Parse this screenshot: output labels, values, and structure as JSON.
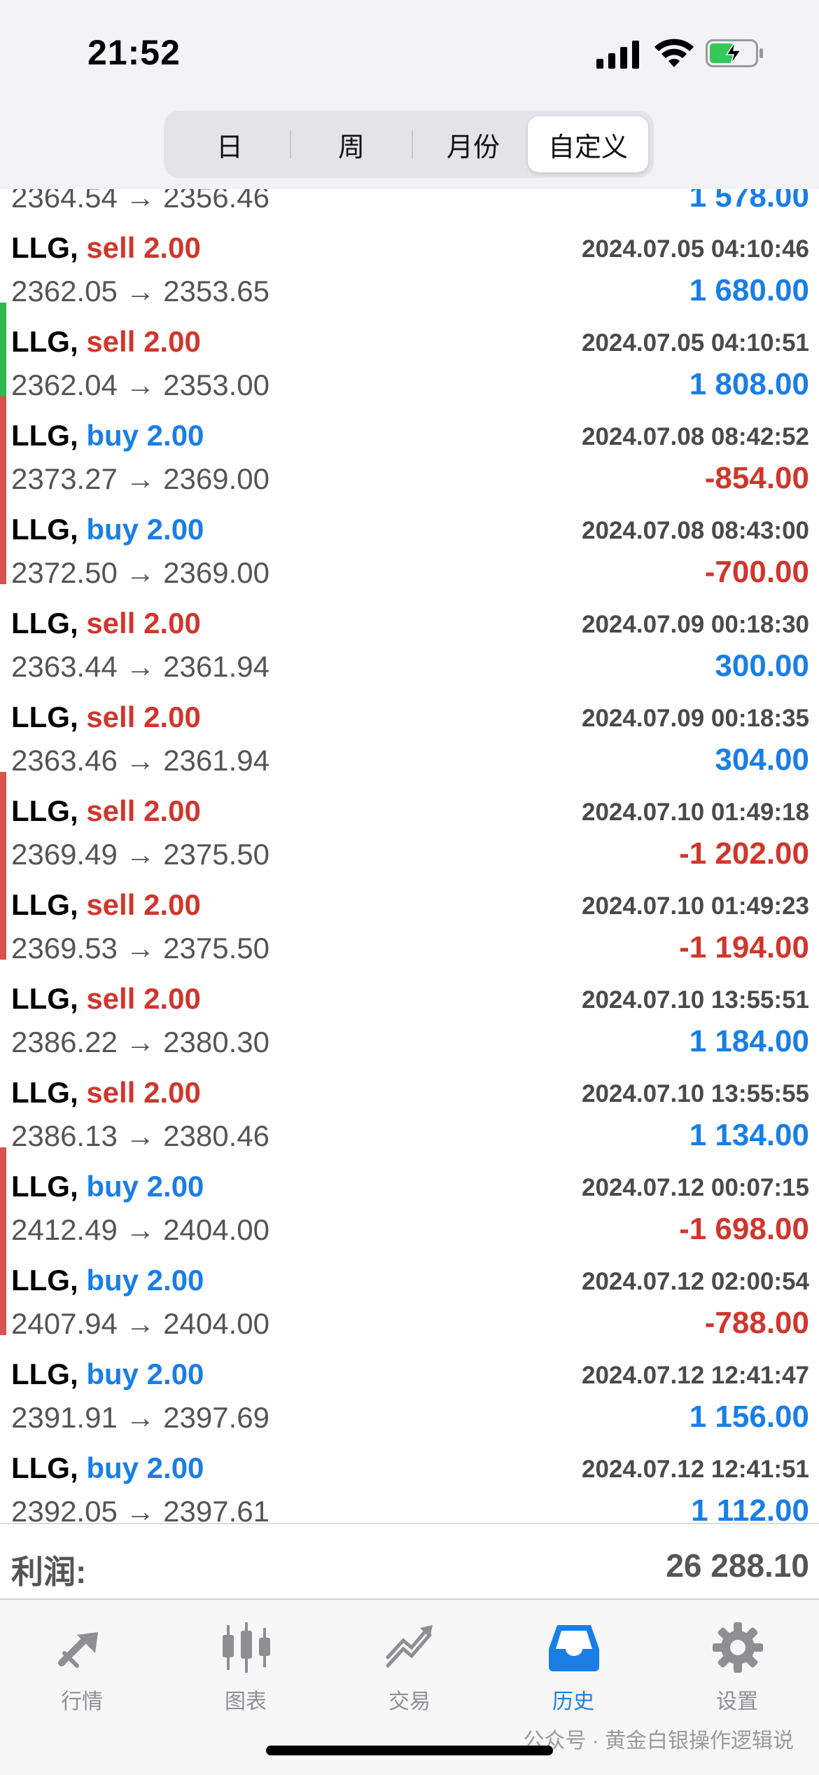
{
  "status": {
    "time": "21:52"
  },
  "segments": [
    {
      "label": "日",
      "active": false
    },
    {
      "label": "周",
      "active": false
    },
    {
      "label": "月份",
      "active": false
    },
    {
      "label": "自定义",
      "active": true
    }
  ],
  "partial_row": {
    "prices": "2364.54 → 2356.46",
    "profit": "1 578.00"
  },
  "trades": [
    {
      "symbol": "LLG,",
      "side": "sell",
      "lots": "2.00",
      "time": "2024.07.05 04:10:46",
      "prices": "2362.05 → 2353.65",
      "profit": "1 680.00",
      "profit_sign": "pos",
      "marker": ""
    },
    {
      "symbol": "LLG,",
      "side": "sell",
      "lots": "2.00",
      "time": "2024.07.05 04:10:51",
      "prices": "2362.04 → 2353.00",
      "profit": "1 808.00",
      "profit_sign": "pos",
      "marker": "#2fb84d"
    },
    {
      "symbol": "LLG,",
      "side": "buy",
      "lots": "2.00",
      "time": "2024.07.08 08:42:52",
      "prices": "2373.27 → 2369.00",
      "profit": "-854.00",
      "profit_sign": "neg",
      "marker": "#d9534f"
    },
    {
      "symbol": "LLG,",
      "side": "buy",
      "lots": "2.00",
      "time": "2024.07.08 08:43:00",
      "prices": "2372.50 → 2369.00",
      "profit": "-700.00",
      "profit_sign": "neg",
      "marker": "#d9534f"
    },
    {
      "symbol": "LLG,",
      "side": "sell",
      "lots": "2.00",
      "time": "2024.07.09 00:18:30",
      "prices": "2363.44 → 2361.94",
      "profit": "300.00",
      "profit_sign": "pos",
      "marker": ""
    },
    {
      "symbol": "LLG,",
      "side": "sell",
      "lots": "2.00",
      "time": "2024.07.09 00:18:35",
      "prices": "2363.46 → 2361.94",
      "profit": "304.00",
      "profit_sign": "pos",
      "marker": ""
    },
    {
      "symbol": "LLG,",
      "side": "sell",
      "lots": "2.00",
      "time": "2024.07.10 01:49:18",
      "prices": "2369.49 → 2375.50",
      "profit": "-1 202.00",
      "profit_sign": "neg",
      "marker": "#d9534f"
    },
    {
      "symbol": "LLG,",
      "side": "sell",
      "lots": "2.00",
      "time": "2024.07.10 01:49:23",
      "prices": "2369.53 → 2375.50",
      "profit": "-1 194.00",
      "profit_sign": "neg",
      "marker": "#d9534f"
    },
    {
      "symbol": "LLG,",
      "side": "sell",
      "lots": "2.00",
      "time": "2024.07.10 13:55:51",
      "prices": "2386.22 → 2380.30",
      "profit": "1 184.00",
      "profit_sign": "pos",
      "marker": ""
    },
    {
      "symbol": "LLG,",
      "side": "sell",
      "lots": "2.00",
      "time": "2024.07.10 13:55:55",
      "prices": "2386.13 → 2380.46",
      "profit": "1 134.00",
      "profit_sign": "pos",
      "marker": ""
    },
    {
      "symbol": "LLG,",
      "side": "buy",
      "lots": "2.00",
      "time": "2024.07.12 00:07:15",
      "prices": "2412.49 → 2404.00",
      "profit": "-1 698.00",
      "profit_sign": "neg",
      "marker": "#d9534f"
    },
    {
      "symbol": "LLG,",
      "side": "buy",
      "lots": "2.00",
      "time": "2024.07.12 02:00:54",
      "prices": "2407.94 → 2404.00",
      "profit": "-788.00",
      "profit_sign": "neg",
      "marker": "#d9534f"
    },
    {
      "symbol": "LLG,",
      "side": "buy",
      "lots": "2.00",
      "time": "2024.07.12 12:41:47",
      "prices": "2391.91 → 2397.69",
      "profit": "1 156.00",
      "profit_sign": "pos",
      "marker": ""
    },
    {
      "symbol": "LLG,",
      "side": "buy",
      "lots": "2.00",
      "time": "2024.07.12 12:41:51",
      "prices": "2392.05 → 2397.61",
      "profit": "1 112.00",
      "profit_sign": "pos",
      "marker": ""
    }
  ],
  "summary": {
    "label": "利润:",
    "value": "26 288.10"
  },
  "tabs": [
    {
      "label": "行情",
      "icon": "quotes-icon",
      "active": false
    },
    {
      "label": "图表",
      "icon": "chart-icon",
      "active": false
    },
    {
      "label": "交易",
      "icon": "trade-icon",
      "active": false
    },
    {
      "label": "历史",
      "icon": "history-icon",
      "active": true
    },
    {
      "label": "设置",
      "icon": "gear-icon",
      "active": false
    }
  ],
  "watermark": "公众号 · 黄金白银操作逻辑说",
  "colors": {
    "accent": "#1a7ee6",
    "sell": "#d0362d",
    "negative": "#d0362d",
    "loss_marker": "#d9534f",
    "win_marker": "#2fb84d"
  }
}
